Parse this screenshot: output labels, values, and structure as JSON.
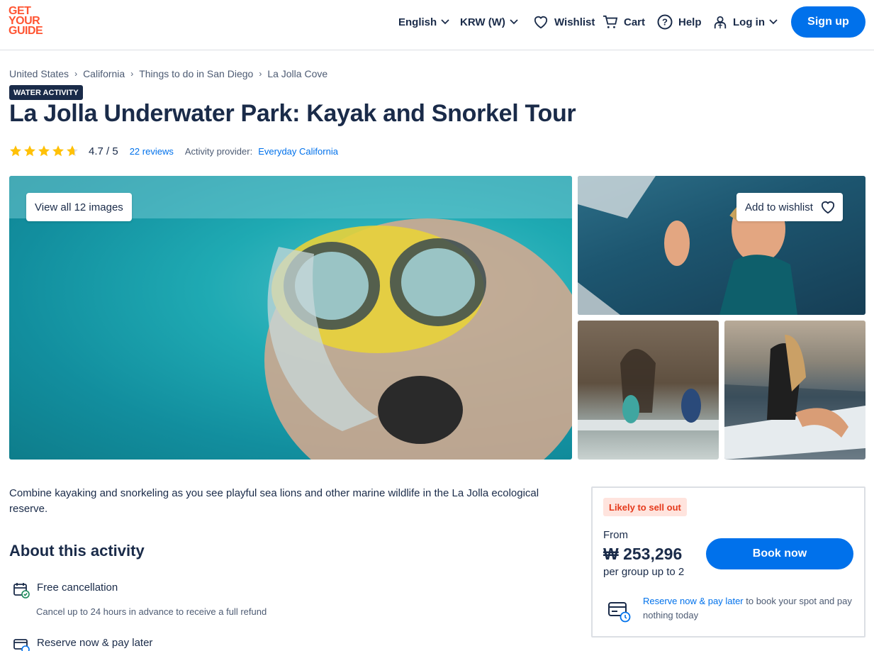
{
  "header": {
    "logo_lines": [
      "GET",
      "YOUR",
      "GUIDE"
    ],
    "language": "English",
    "currency": "KRW (W)",
    "wishlist": "Wishlist",
    "cart": "Cart",
    "help": "Help",
    "login": "Log in",
    "signup": "Sign up"
  },
  "breadcrumb": [
    "United States",
    "California",
    "Things to do in San Diego",
    "La Jolla Cove"
  ],
  "badge": "WATER ACTIVITY",
  "title": "La Jolla Underwater Park: Kayak and Snorkel Tour",
  "rating": {
    "score": "4.7 / 5",
    "stars_value": 4.7,
    "reviews": "22 reviews",
    "provider_label": "Activity provider:",
    "provider": "Everyday California"
  },
  "gallery": {
    "view_all": "View all 12 images",
    "add_wishlist": "Add to wishlist"
  },
  "intro": "Combine kayaking and snorkeling as you see playful sea lions and other marine wildlife in the La Jolla ecological reserve.",
  "about": {
    "title": "About this activity",
    "features": [
      {
        "title": "Free cancellation",
        "subtitle": "Cancel up to 24 hours in advance to receive a full refund"
      },
      {
        "title": "Reserve now & pay later"
      }
    ]
  },
  "booking": {
    "pill": "Likely to sell out",
    "from": "From",
    "price": "₩ 253,296",
    "per": "per group up to 2",
    "book": "Book now",
    "reserve_link": "Reserve now & pay later",
    "reserve_text": " to book your spot and pay nothing today"
  },
  "colors": {
    "brand": "#ff5533",
    "accent": "#0071eb",
    "text": "#1a2b49",
    "star": "#ffc107"
  }
}
